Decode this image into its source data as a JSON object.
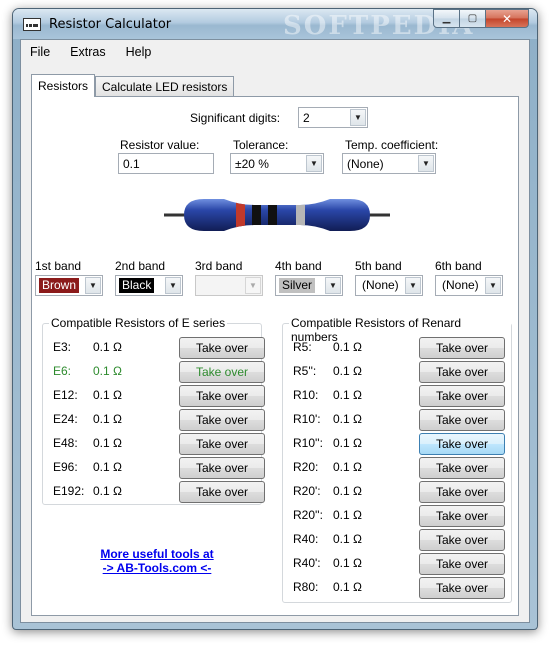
{
  "window": {
    "title": "Resistor Calculator",
    "watermark": "SOFTPEDIA",
    "buttons": {
      "minimize": "▁",
      "maximize": "▢",
      "close": "✕"
    }
  },
  "menu": [
    "File",
    "Extras",
    "Help"
  ],
  "tabs": [
    {
      "label": "Resistors",
      "active": true
    },
    {
      "label": "Calculate LED resistors",
      "active": false
    }
  ],
  "significant_digits": {
    "label": "Significant digits:",
    "value": "2"
  },
  "resistor_value": {
    "label": "Resistor value:",
    "value": "0.1"
  },
  "tolerance": {
    "label": "Tolerance:",
    "value": "±20 %"
  },
  "temp_coefficient": {
    "label": "Temp. coefficient:",
    "value": "(None)"
  },
  "resistor_image": {
    "body_color": "#2a46a8",
    "bands": [
      "#c0392b",
      "#111111",
      "#111111",
      "#b6b6b6"
    ]
  },
  "bands": [
    {
      "label": "1st band",
      "value": "Brown",
      "bg": "#8b1a1a",
      "fg": "#ffffff",
      "enabled": true
    },
    {
      "label": "2nd band",
      "value": "Black",
      "bg": "#000000",
      "fg": "#ffffff",
      "enabled": true
    },
    {
      "label": "3rd band",
      "value": "",
      "bg": "",
      "fg": "",
      "enabled": false
    },
    {
      "label": "4th band",
      "value": "Silver",
      "bg": "#c0c0c0",
      "fg": "#000000",
      "enabled": true
    },
    {
      "label": "5th band",
      "value": "(None)",
      "bg": "",
      "fg": "",
      "enabled": true
    },
    {
      "label": "6th band",
      "value": "(None)",
      "bg": "",
      "fg": "",
      "enabled": true
    }
  ],
  "e_series": {
    "title": "Compatible Resistors of E series",
    "button_label": "Take over",
    "rows": [
      {
        "name": "E3:",
        "value": "0.1 Ω",
        "highlight": false
      },
      {
        "name": "E6:",
        "value": "0.1 Ω",
        "highlight": true
      },
      {
        "name": "E12:",
        "value": "0.1 Ω",
        "highlight": false
      },
      {
        "name": "E24:",
        "value": "0.1 Ω",
        "highlight": false
      },
      {
        "name": "E48:",
        "value": "0.1 Ω",
        "highlight": false
      },
      {
        "name": "E96:",
        "value": "0.1 Ω",
        "highlight": false
      },
      {
        "name": "E192:",
        "value": "0.1 Ω",
        "highlight": false
      }
    ]
  },
  "renard": {
    "title": "Compatible Resistors of Renard numbers",
    "button_label": "Take over",
    "rows": [
      {
        "name": "R5:",
        "value": "0.1 Ω",
        "hover": false
      },
      {
        "name": "R5'':",
        "value": "0.1 Ω",
        "hover": false
      },
      {
        "name": "R10:",
        "value": "0.1 Ω",
        "hover": false
      },
      {
        "name": "R10':",
        "value": "0.1 Ω",
        "hover": false
      },
      {
        "name": "R10'':",
        "value": "0.1 Ω",
        "hover": true
      },
      {
        "name": "R20:",
        "value": "0.1 Ω",
        "hover": false
      },
      {
        "name": "R20':",
        "value": "0.1 Ω",
        "hover": false
      },
      {
        "name": "R20'':",
        "value": "0.1 Ω",
        "hover": false
      },
      {
        "name": "R40:",
        "value": "0.1 Ω",
        "hover": false
      },
      {
        "name": "R40':",
        "value": "0.1 Ω",
        "hover": false
      },
      {
        "name": "R80:",
        "value": "0.1 Ω",
        "hover": false
      }
    ]
  },
  "link": {
    "line1": "More useful tools at",
    "line2": "-> AB-Tools.com <-"
  },
  "colors": {
    "highlight_green": "#2e8b2e",
    "link_blue": "#0000ee"
  }
}
